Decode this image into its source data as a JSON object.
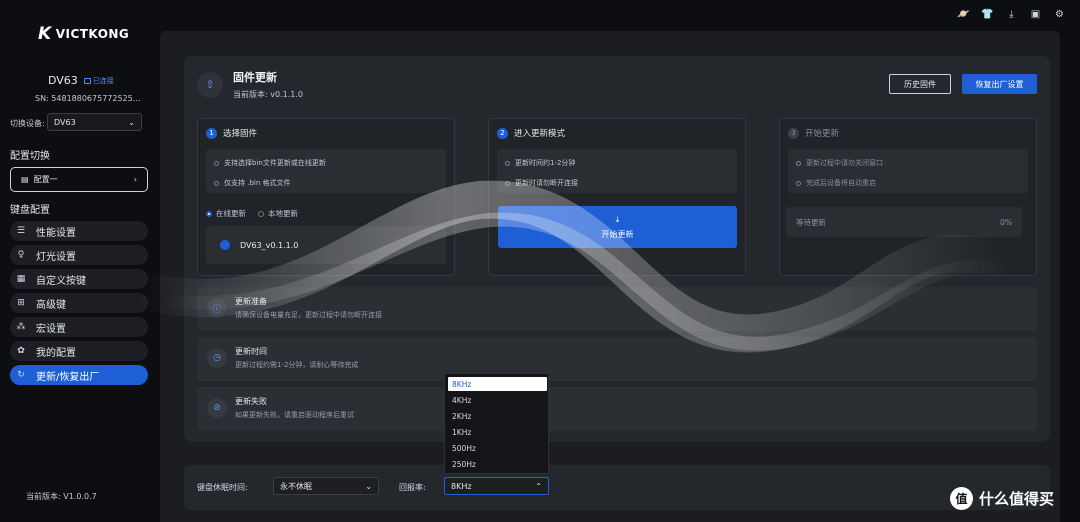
{
  "brand": "VICTKONG",
  "device": {
    "name": "DV63",
    "status": "已连接",
    "sn": "SN: 5481880675772525...",
    "switch_label": "切换设备:",
    "switch_value": "DV63"
  },
  "profile": {
    "section": "配置切换",
    "current": "配置一"
  },
  "nav": {
    "section": "键盘配置",
    "items": [
      {
        "label": "性能设置",
        "icon": "sliders-icon"
      },
      {
        "label": "灯光设置",
        "icon": "bulb-icon"
      },
      {
        "label": "自定义按键",
        "icon": "keyboard-icon"
      },
      {
        "label": "高级键",
        "icon": "grid-icon"
      },
      {
        "label": "宏设置",
        "icon": "macro-icon"
      },
      {
        "label": "我的配置",
        "icon": "settings-icon"
      },
      {
        "label": "更新/恢复出厂",
        "icon": "refresh-icon"
      }
    ]
  },
  "app_version": "当前版本: V1.0.0.7",
  "firmware": {
    "title": "固件更新",
    "current": "当前版本: v0.1.1.0",
    "history_button": "历史固件",
    "reset_button": "恢复出厂设置"
  },
  "steps": [
    {
      "num": "1",
      "title": "选择固件",
      "lines": [
        "支持选择bin文件更新或在线更新",
        "仅支持 .bin 格式文件"
      ]
    },
    {
      "num": "2",
      "title": "进入更新模式",
      "lines": [
        "更新时间约1-2分钟",
        "更新时请勿断开连接"
      ],
      "button": "开始更新"
    },
    {
      "num": "3",
      "title": "开始更新",
      "lines": [
        "更新过程中请勿关闭窗口",
        "完成后设备将自动重启"
      ],
      "wait_label": "等待更新",
      "wait_value": "0%"
    }
  ],
  "mode": {
    "online": "在线更新",
    "local": "本地更新"
  },
  "file": "DV63_v0.1.1.0",
  "info": [
    {
      "title": "更新准备",
      "desc": "请确保设备电量充足，更新过程中请勿断开连接"
    },
    {
      "title": "更新时间",
      "desc": "更新过程约需1-2分钟，请耐心等待完成"
    },
    {
      "title": "更新失败",
      "desc": "如果更新失败，请重启驱动程序后重试"
    }
  ],
  "bottom": {
    "sleep_label": "键盘休眠时间:",
    "sleep_value": "永不休眠",
    "rate_label": "回报率:",
    "rate_value": "8KHz",
    "rate_options": [
      "8KHz",
      "4KHz",
      "2KHz",
      "1KHz",
      "500Hz",
      "250Hz"
    ]
  },
  "watermark": "什么值得买",
  "watermark_mark": "值"
}
